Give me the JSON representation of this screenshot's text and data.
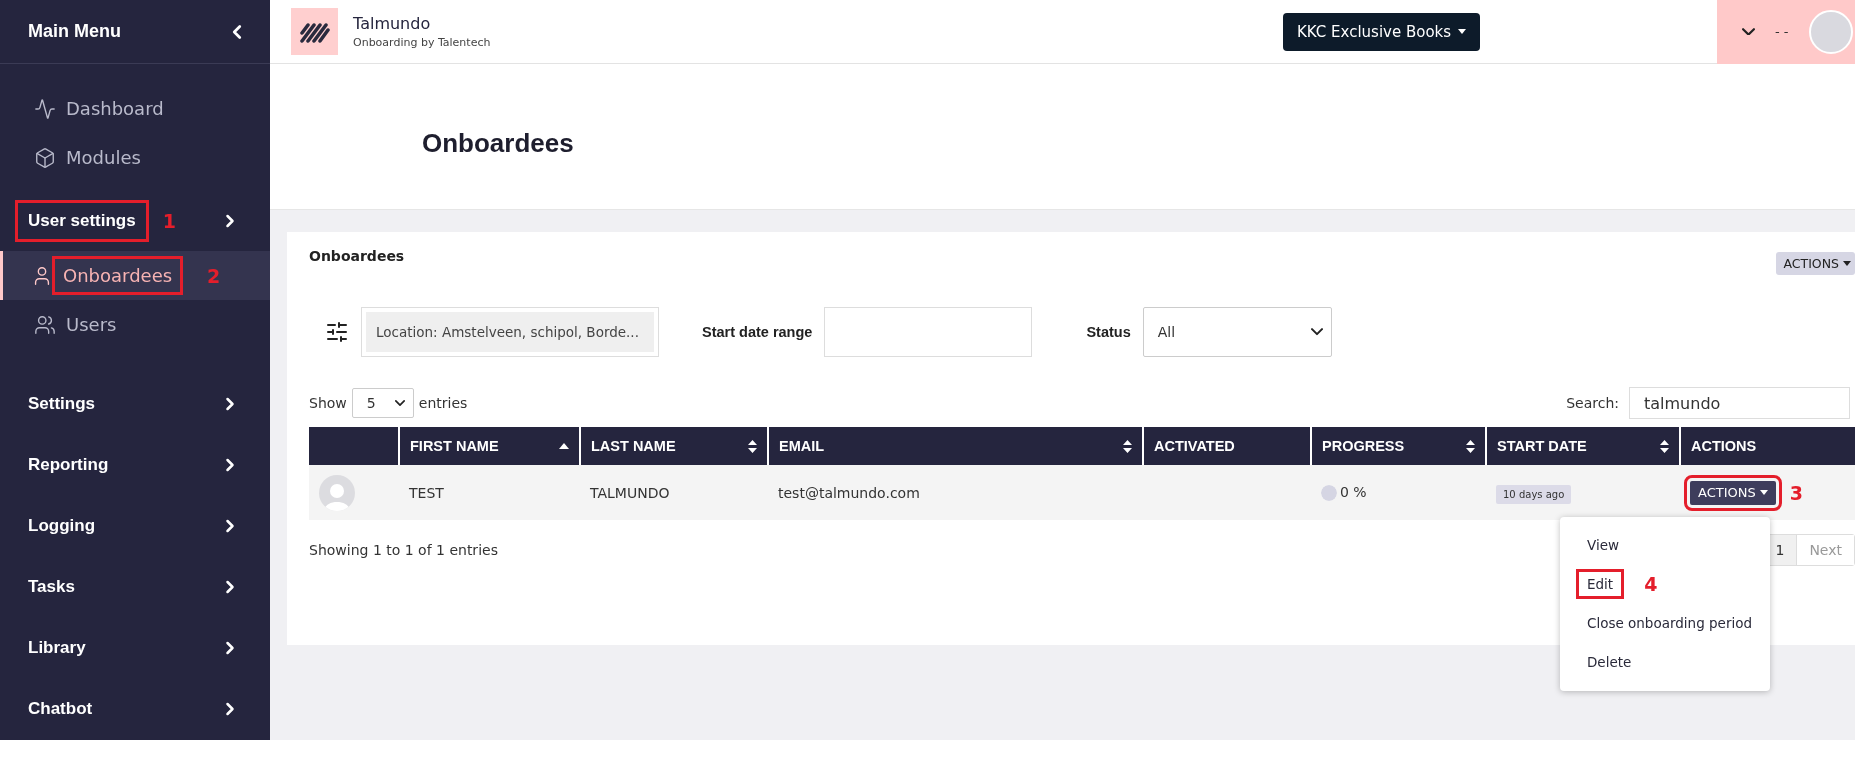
{
  "sidebar": {
    "title": "Main Menu",
    "links": [
      {
        "label": "Dashboard",
        "selected": false
      },
      {
        "label": "Modules",
        "selected": false
      },
      {
        "label": "User settings",
        "kind": "section",
        "callout": "1"
      },
      {
        "label": "Onboardees",
        "selected": true,
        "callout": "2"
      },
      {
        "label": "Users",
        "selected": false
      }
    ],
    "sections": [
      {
        "label": "Settings"
      },
      {
        "label": "Reporting"
      },
      {
        "label": "Logging"
      },
      {
        "label": "Tasks"
      },
      {
        "label": "Library"
      },
      {
        "label": "Chatbot"
      }
    ]
  },
  "header": {
    "brand": {
      "name": "Talmundo",
      "tagline": "Onboarding by Talentech"
    },
    "company_button": "KKC Exclusive Books",
    "user_name": "- -"
  },
  "page_title": "Onboardees",
  "card": {
    "title": "Onboardees",
    "actions_button": "ACTIONS",
    "filters": {
      "location": "Location: Amstelveen, schipol, Borde...",
      "date_label": "Start date range",
      "status_label": "Status",
      "status_value": "All"
    },
    "length": {
      "prefix": "Show",
      "value": "5",
      "suffix": "entries"
    },
    "search": {
      "label": "Search:",
      "value": "talmundo"
    },
    "table": {
      "columns": [
        {
          "label": "FIRST NAME",
          "sortable": true,
          "sorted": true
        },
        {
          "label": "LAST NAME",
          "sortable": true,
          "sorted": false
        },
        {
          "label": "EMAIL",
          "sortable": true,
          "sorted": false
        },
        {
          "label": "ACTIVATED",
          "sortable": false,
          "sorted": false
        },
        {
          "label": "PROGRESS",
          "sortable": true,
          "sorted": false
        },
        {
          "label": "START DATE",
          "sortable": true,
          "sorted": false
        },
        {
          "label": "ACTIONS",
          "sortable": false,
          "sorted": false
        }
      ],
      "rows": [
        {
          "first_name": "TEST",
          "last_name": "TALMUNDO",
          "email": "test@talmundo.com",
          "progress": {
            "reading": "0 %"
          },
          "start_date": "10 days ago",
          "actions": {
            "label": "ACTIONS",
            "callout": "3"
          }
        }
      ]
    },
    "info": "Showing 1 to 1 of 1 entries",
    "pagination": {
      "pages": [
        {
          "label": "1",
          "selected": true
        }
      ],
      "next": {
        "label": "Next",
        "disabled": true
      }
    },
    "menu": {
      "items": [
        {
          "label": "View"
        },
        {
          "label": "Edit",
          "callout": "4"
        },
        {
          "label": "Close onboarding period"
        },
        {
          "label": "Delete"
        }
      ]
    }
  }
}
